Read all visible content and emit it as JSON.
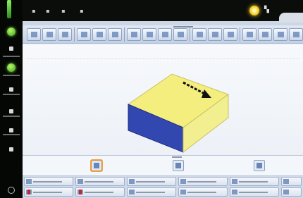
{
  "window": {
    "title": ""
  },
  "colors": {
    "sidebar_bg": "#050705",
    "accent_green": "#5fd12a",
    "box_top": "#f4ee7f",
    "box_front": "#3248b0",
    "arrow": "#111111",
    "selection_orange": "#f2a33a"
  },
  "sidebar": {
    "items": [
      {
        "icon": "status-bar-icon"
      },
      {
        "icon": "green-status-dot-icon"
      },
      {
        "icon": "user-icon"
      },
      {
        "icon": "green-status-dot-icon"
      },
      {
        "icon": "tool-icon"
      },
      {
        "icon": "settings-icon"
      },
      {
        "icon": "folder-icon"
      },
      {
        "icon": "info-icon"
      }
    ]
  },
  "topbar": {
    "icons": [
      "back-icon",
      "forward-icon",
      "cube-icon",
      "tools-icon"
    ],
    "status_icon": "sun-icon"
  },
  "toolbar": {
    "tools": 16
  },
  "viewport": {
    "object": "isometric-box",
    "direction_arrow": "direction-arrow"
  },
  "views": [
    {
      "icon": "view-front-icon",
      "selected": true
    },
    {
      "icon": "view-side-icon",
      "selected": false
    },
    {
      "icon": "view-top-icon",
      "selected": false
    }
  ],
  "bottom_panels": 10
}
